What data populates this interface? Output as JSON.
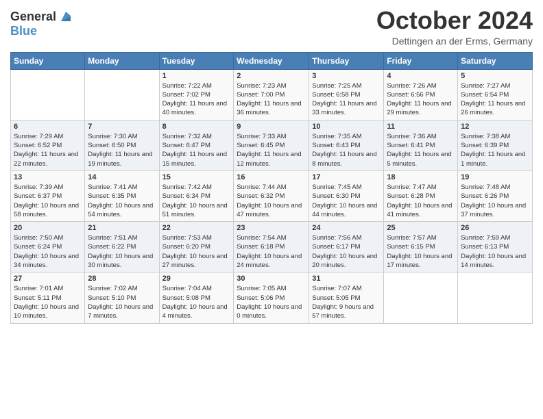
{
  "header": {
    "logo_general": "General",
    "logo_blue": "Blue",
    "month_title": "October 2024",
    "subtitle": "Dettingen an der Erms, Germany"
  },
  "weekdays": [
    "Sunday",
    "Monday",
    "Tuesday",
    "Wednesday",
    "Thursday",
    "Friday",
    "Saturday"
  ],
  "weeks": [
    [
      {
        "day": "",
        "info": ""
      },
      {
        "day": "",
        "info": ""
      },
      {
        "day": "1",
        "info": "Sunrise: 7:22 AM\nSunset: 7:02 PM\nDaylight: 11 hours and 40 minutes."
      },
      {
        "day": "2",
        "info": "Sunrise: 7:23 AM\nSunset: 7:00 PM\nDaylight: 11 hours and 36 minutes."
      },
      {
        "day": "3",
        "info": "Sunrise: 7:25 AM\nSunset: 6:58 PM\nDaylight: 11 hours and 33 minutes."
      },
      {
        "day": "4",
        "info": "Sunrise: 7:26 AM\nSunset: 6:56 PM\nDaylight: 11 hours and 29 minutes."
      },
      {
        "day": "5",
        "info": "Sunrise: 7:27 AM\nSunset: 6:54 PM\nDaylight: 11 hours and 26 minutes."
      }
    ],
    [
      {
        "day": "6",
        "info": "Sunrise: 7:29 AM\nSunset: 6:52 PM\nDaylight: 11 hours and 22 minutes."
      },
      {
        "day": "7",
        "info": "Sunrise: 7:30 AM\nSunset: 6:50 PM\nDaylight: 11 hours and 19 minutes."
      },
      {
        "day": "8",
        "info": "Sunrise: 7:32 AM\nSunset: 6:47 PM\nDaylight: 11 hours and 15 minutes."
      },
      {
        "day": "9",
        "info": "Sunrise: 7:33 AM\nSunset: 6:45 PM\nDaylight: 11 hours and 12 minutes."
      },
      {
        "day": "10",
        "info": "Sunrise: 7:35 AM\nSunset: 6:43 PM\nDaylight: 11 hours and 8 minutes."
      },
      {
        "day": "11",
        "info": "Sunrise: 7:36 AM\nSunset: 6:41 PM\nDaylight: 11 hours and 5 minutes."
      },
      {
        "day": "12",
        "info": "Sunrise: 7:38 AM\nSunset: 6:39 PM\nDaylight: 11 hours and 1 minute."
      }
    ],
    [
      {
        "day": "13",
        "info": "Sunrise: 7:39 AM\nSunset: 6:37 PM\nDaylight: 10 hours and 58 minutes."
      },
      {
        "day": "14",
        "info": "Sunrise: 7:41 AM\nSunset: 6:35 PM\nDaylight: 10 hours and 54 minutes."
      },
      {
        "day": "15",
        "info": "Sunrise: 7:42 AM\nSunset: 6:34 PM\nDaylight: 10 hours and 51 minutes."
      },
      {
        "day": "16",
        "info": "Sunrise: 7:44 AM\nSunset: 6:32 PM\nDaylight: 10 hours and 47 minutes."
      },
      {
        "day": "17",
        "info": "Sunrise: 7:45 AM\nSunset: 6:30 PM\nDaylight: 10 hours and 44 minutes."
      },
      {
        "day": "18",
        "info": "Sunrise: 7:47 AM\nSunset: 6:28 PM\nDaylight: 10 hours and 41 minutes."
      },
      {
        "day": "19",
        "info": "Sunrise: 7:48 AM\nSunset: 6:26 PM\nDaylight: 10 hours and 37 minutes."
      }
    ],
    [
      {
        "day": "20",
        "info": "Sunrise: 7:50 AM\nSunset: 6:24 PM\nDaylight: 10 hours and 34 minutes."
      },
      {
        "day": "21",
        "info": "Sunrise: 7:51 AM\nSunset: 6:22 PM\nDaylight: 10 hours and 30 minutes."
      },
      {
        "day": "22",
        "info": "Sunrise: 7:53 AM\nSunset: 6:20 PM\nDaylight: 10 hours and 27 minutes."
      },
      {
        "day": "23",
        "info": "Sunrise: 7:54 AM\nSunset: 6:18 PM\nDaylight: 10 hours and 24 minutes."
      },
      {
        "day": "24",
        "info": "Sunrise: 7:56 AM\nSunset: 6:17 PM\nDaylight: 10 hours and 20 minutes."
      },
      {
        "day": "25",
        "info": "Sunrise: 7:57 AM\nSunset: 6:15 PM\nDaylight: 10 hours and 17 minutes."
      },
      {
        "day": "26",
        "info": "Sunrise: 7:59 AM\nSunset: 6:13 PM\nDaylight: 10 hours and 14 minutes."
      }
    ],
    [
      {
        "day": "27",
        "info": "Sunrise: 7:01 AM\nSunset: 5:11 PM\nDaylight: 10 hours and 10 minutes."
      },
      {
        "day": "28",
        "info": "Sunrise: 7:02 AM\nSunset: 5:10 PM\nDaylight: 10 hours and 7 minutes."
      },
      {
        "day": "29",
        "info": "Sunrise: 7:04 AM\nSunset: 5:08 PM\nDaylight: 10 hours and 4 minutes."
      },
      {
        "day": "30",
        "info": "Sunrise: 7:05 AM\nSunset: 5:06 PM\nDaylight: 10 hours and 0 minutes."
      },
      {
        "day": "31",
        "info": "Sunrise: 7:07 AM\nSunset: 5:05 PM\nDaylight: 9 hours and 57 minutes."
      },
      {
        "day": "",
        "info": ""
      },
      {
        "day": "",
        "info": ""
      }
    ]
  ]
}
